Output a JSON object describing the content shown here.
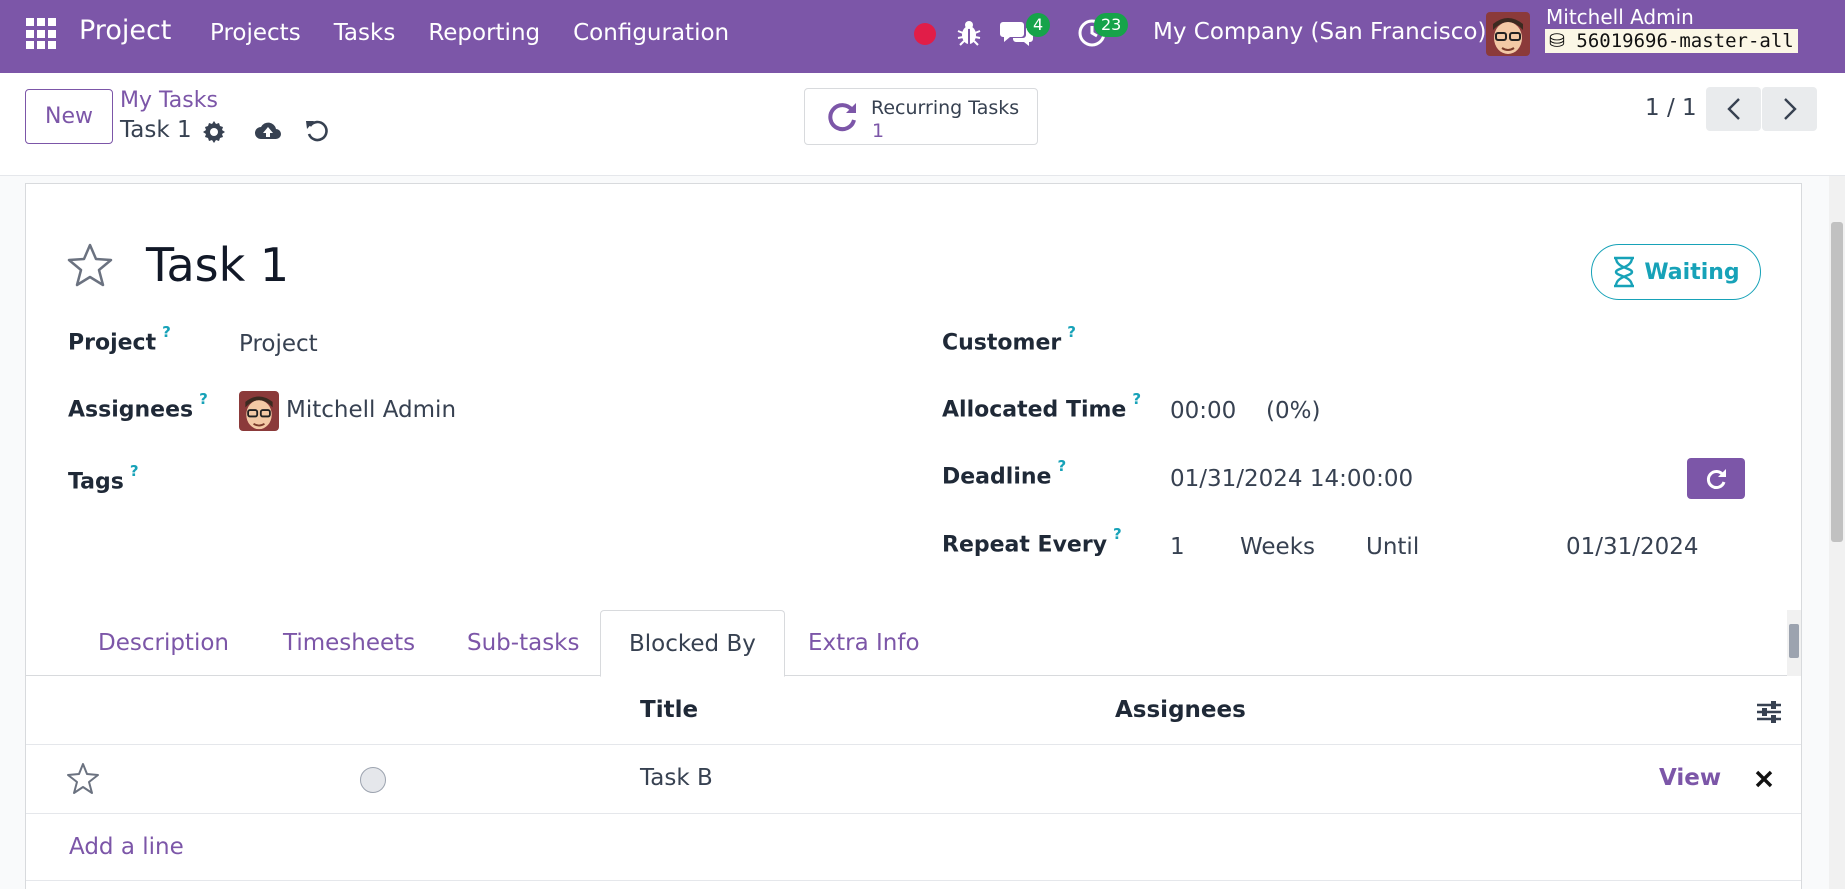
{
  "navbar": {
    "brand": "Project",
    "menu": [
      "Projects",
      "Tasks",
      "Reporting",
      "Configuration"
    ],
    "messages_count": "4",
    "activities_count": "23",
    "company": "My Company (San Francisco)",
    "user_name": "Mitchell Admin",
    "database": "56019696-master-all",
    "accent_color": "#7c56a8"
  },
  "control_panel": {
    "new_label": "New",
    "breadcrumb_parent": "My Tasks",
    "breadcrumb_current": "Task 1",
    "smart_button": {
      "label": "Recurring Tasks",
      "value": "1"
    },
    "pager": "1 / 1"
  },
  "form": {
    "title": "Task 1",
    "state": "Waiting",
    "fields": {
      "project_label": "Project",
      "project_value": "Project",
      "assignees_label": "Assignees",
      "assignees_value": "Mitchell Admin",
      "tags_label": "Tags",
      "customer_label": "Customer",
      "allocated_time_label": "Allocated Time",
      "allocated_time_value": "00:00",
      "allocated_time_percent": "(0%)",
      "deadline_label": "Deadline",
      "deadline_value": "01/31/2024 14:00:00",
      "repeat_every_label": "Repeat Every",
      "repeat_interval": "1",
      "repeat_unit": "Weeks",
      "repeat_type": "Until",
      "repeat_until": "01/31/2024"
    },
    "help_mark": "?"
  },
  "tabs": [
    {
      "label": "Description",
      "active": false
    },
    {
      "label": "Timesheets",
      "active": false
    },
    {
      "label": "Sub-tasks",
      "active": false
    },
    {
      "label": "Blocked By",
      "active": true
    },
    {
      "label": "Extra Info",
      "active": false
    }
  ],
  "table": {
    "columns": [
      "Title",
      "Assignees"
    ],
    "rows": [
      {
        "title": "Task B",
        "assignees": "",
        "action": "View"
      }
    ],
    "add_line": "Add a line"
  }
}
